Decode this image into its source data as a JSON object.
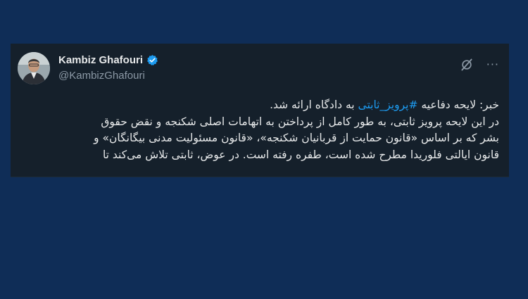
{
  "tweet": {
    "author": {
      "display_name": "Kambiz Ghafouri",
      "handle": "@KambizGhafouri",
      "verified": true
    },
    "actions": {
      "grok_icon": "grok-icon",
      "more_icon": "more-icon",
      "more_glyph": "···"
    },
    "text": {
      "line1_prefix": "خبر: لایحه دفاعیه ",
      "hashtag": "#پرویز_ثابتی",
      "line1_suffix": " به دادگاه ارائه شد.",
      "line2": "در این لایحه پرویز ثابتی، به طور کامل از پرداختن به اتهامات اصلی شکنجه و نقض حقوق",
      "line3": "بشر که بر اساس «قانون حمایت از قربانیان شکنجه»، «قانون مسئولیت مدنی بیگانگان» و",
      "line4": "قانون ایالتی فلوریدا مطرح شده است، طفره رفته است. در عوض، ثابتی تلاش می‌کند تا"
    },
    "colors": {
      "page_background": "#0f2d57",
      "card_background": "#15202b",
      "primary_text": "#e7e9ea",
      "secondary_text": "#8b98a5",
      "link": "#1d9bf0",
      "verified_badge": "#1d9bf0"
    }
  }
}
